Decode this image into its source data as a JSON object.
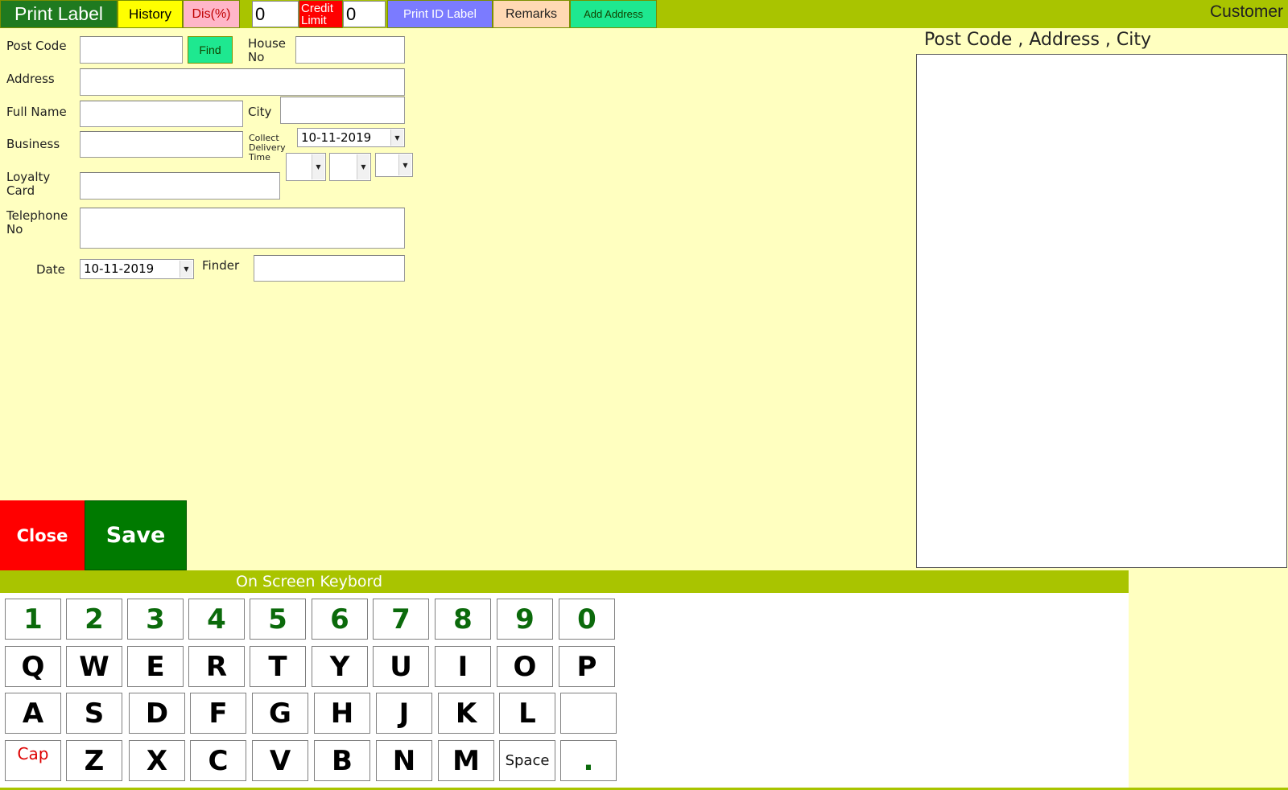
{
  "topbar": {
    "print_label": "Print Label",
    "history": "History",
    "discount": "Dis(%)",
    "discount_value": "0",
    "credit_limit": "Credit Limit",
    "credit_value": "0",
    "print_id_label": "Print ID Label",
    "remarks": "Remarks",
    "add_address": "Add Address",
    "customer": "Customer"
  },
  "form": {
    "post_code_label": "Post Code",
    "find_button": "Find",
    "house_no_label": "House No",
    "address_label": "Address",
    "full_name_label": "Full Name",
    "city_label": "City",
    "business_label": "Business",
    "collect_delivery_time_label": "Collect Delivery Time",
    "collect_date": "10-11-2019",
    "loyalty_card_label": "Loyalty Card",
    "telephone_label": "Telephone No",
    "date_label": "Date",
    "date_value": "10-11-2019",
    "finder_label": "Finder"
  },
  "actions": {
    "close": "Close",
    "save": "Save"
  },
  "address_panel": {
    "title": "Post Code , Address , City"
  },
  "keyboard": {
    "title": "On Screen Keybord",
    "row1": [
      "1",
      "2",
      "3",
      "4",
      "5",
      "6",
      "7",
      "8",
      "9",
      "0"
    ],
    "row2": [
      "Q",
      "W",
      "E",
      "R",
      "T",
      "Y",
      "U",
      "I",
      "O",
      "P"
    ],
    "row3": [
      "A",
      "S",
      "D",
      "F",
      "G",
      "H",
      "J",
      "K",
      "L",
      ""
    ],
    "row4": [
      "Z",
      "X",
      "C",
      "V",
      "B",
      "N",
      "M"
    ],
    "cap": "Cap",
    "space": "Space",
    "dot": "."
  },
  "colors": {
    "bar_green": "#a9c400",
    "background": "#ffffc0",
    "close_red": "#ff0000",
    "save_green": "#007a00"
  }
}
